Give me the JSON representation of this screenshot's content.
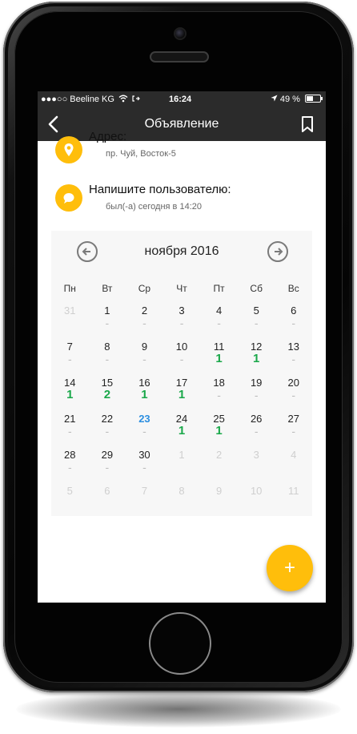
{
  "statusbar": {
    "carrier": "●●●○○ Beeline KG",
    "time": "16:24",
    "battery": "49 %"
  },
  "navbar": {
    "title": "Объявление",
    "back_icon": "chevron-left-icon",
    "bookmark_icon": "bookmark-icon"
  },
  "info": {
    "address_title": "Адрес:",
    "address_value": "пр. Чуй, Восток-5",
    "message_title": "Напишите пользователю:",
    "message_status": "был(-а) сегодня в 14:20"
  },
  "calendar": {
    "month_label": "ноября 2016",
    "weekdays": [
      "Пн",
      "Вт",
      "Ср",
      "Чт",
      "Пт",
      "Сб",
      "Вс"
    ],
    "weeks": [
      [
        {
          "d": "31",
          "c": "",
          "m": true
        },
        {
          "d": "1",
          "c": "-"
        },
        {
          "d": "2",
          "c": "-"
        },
        {
          "d": "3",
          "c": "-"
        },
        {
          "d": "4",
          "c": "-"
        },
        {
          "d": "5",
          "c": "-"
        },
        {
          "d": "6",
          "c": "-"
        }
      ],
      [
        {
          "d": "7",
          "c": "-"
        },
        {
          "d": "8",
          "c": "-"
        },
        {
          "d": "9",
          "c": "-"
        },
        {
          "d": "10",
          "c": "-"
        },
        {
          "d": "11",
          "c": "1"
        },
        {
          "d": "12",
          "c": "1"
        },
        {
          "d": "13",
          "c": "-"
        }
      ],
      [
        {
          "d": "14",
          "c": "1"
        },
        {
          "d": "15",
          "c": "2"
        },
        {
          "d": "16",
          "c": "1"
        },
        {
          "d": "17",
          "c": "1"
        },
        {
          "d": "18",
          "c": "-"
        },
        {
          "d": "19",
          "c": "-"
        },
        {
          "d": "20",
          "c": "-"
        }
      ],
      [
        {
          "d": "21",
          "c": "-"
        },
        {
          "d": "22",
          "c": "-"
        },
        {
          "d": "23",
          "c": "-",
          "t": true
        },
        {
          "d": "24",
          "c": "1"
        },
        {
          "d": "25",
          "c": "1"
        },
        {
          "d": "26",
          "c": "-"
        },
        {
          "d": "27",
          "c": "-"
        }
      ],
      [
        {
          "d": "28",
          "c": "-"
        },
        {
          "d": "29",
          "c": "-"
        },
        {
          "d": "30",
          "c": "-"
        },
        {
          "d": "1",
          "c": "",
          "m": true
        },
        {
          "d": "2",
          "c": "",
          "m": true
        },
        {
          "d": "3",
          "c": "",
          "m": true
        },
        {
          "d": "4",
          "c": "",
          "m": true
        }
      ],
      [
        {
          "d": "5",
          "c": "",
          "m": true
        },
        {
          "d": "6",
          "c": "",
          "m": true
        },
        {
          "d": "7",
          "c": "",
          "m": true
        },
        {
          "d": "8",
          "c": "",
          "m": true
        },
        {
          "d": "9",
          "c": "",
          "m": true
        },
        {
          "d": "10",
          "c": "",
          "m": true
        },
        {
          "d": "11",
          "c": "",
          "m": true
        }
      ]
    ]
  },
  "fab": {
    "label": "+"
  },
  "colors": {
    "accent": "#ffbe0b",
    "count": "#1aa84a",
    "today": "#2d8fe0",
    "bar": "#2b2b2b"
  }
}
